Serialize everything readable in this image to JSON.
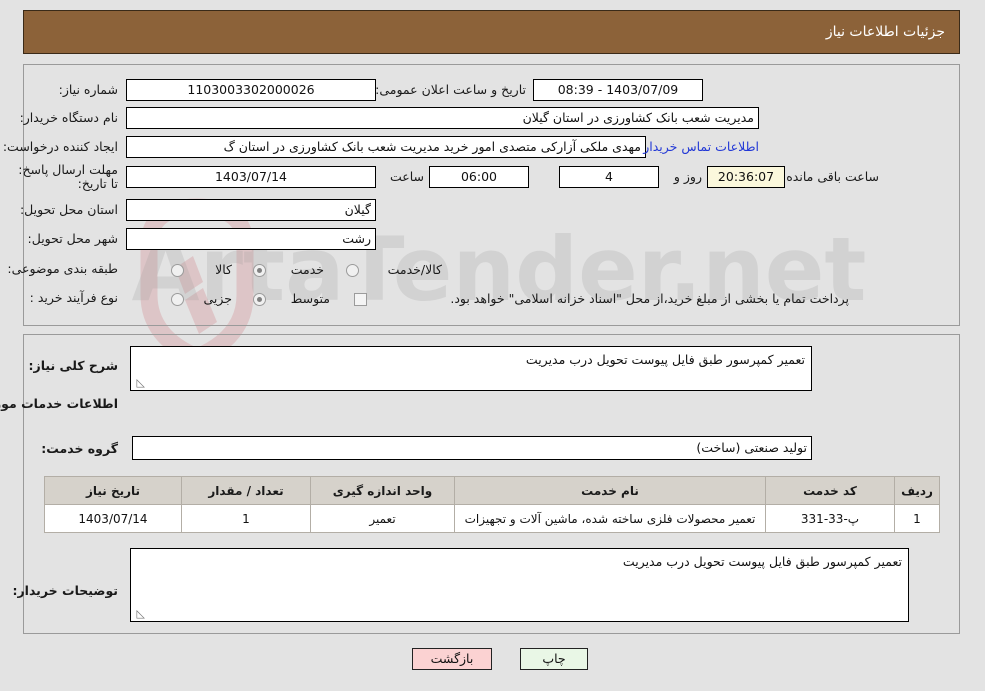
{
  "header": {
    "title": "جزئیات اطلاعات نیاز"
  },
  "form": {
    "need_number_label": "شماره نیاز:",
    "need_number_value": "1103003302000026",
    "announce_datetime_label": "تاریخ و ساعت اعلان عمومی:",
    "announce_datetime_value": "1403/07/09 - 08:39",
    "buyer_org_label": "نام دستگاه خریدار:",
    "buyer_org_value": "مدیریت شعب بانک کشاورزی در استان گیلان",
    "creator_label": "ایجاد کننده درخواست:",
    "creator_value": "مهدی ملکی آزارکی متصدی امور خرید مدیریت شعب بانک کشاورزی در استان گ",
    "contact_link": "اطلاعات تماس خریدار",
    "deadline_label": "مهلت ارسال پاسخ: تا تاریخ:",
    "deadline_date": "1403/07/14",
    "deadline_time_label": "ساعت",
    "deadline_time": "06:00",
    "remaining_days": "4",
    "days_and_label": "روز و",
    "remaining_clock": "20:36:07",
    "remaining_suffix": "ساعت باقی مانده",
    "province_label": "استان محل تحویل:",
    "province_value": "گیلان",
    "city_label": "شهر محل تحویل:",
    "city_value": "رشت",
    "category_label": "طبقه بندی موضوعی:",
    "category_options": [
      {
        "label": "کالا",
        "selected": false
      },
      {
        "label": "خدمت",
        "selected": true
      },
      {
        "label": "کالا/خدمت",
        "selected": false
      }
    ],
    "process_label": "نوع فرآیند خرید :",
    "process_options": [
      {
        "label": "جزیی",
        "selected": false
      },
      {
        "label": "متوسط",
        "selected": true
      }
    ],
    "treasury_checked": false,
    "treasury_note": "پرداخت تمام یا بخشی از مبلغ خرید،از محل \"اسناد خزانه اسلامی\" خواهد بود."
  },
  "details": {
    "summary_label": "شرح کلی نیاز:",
    "summary_value": "تعمیر کمپرسور  طبق فایل پیوست تحویل درب مدیریت",
    "services_heading": "اطلاعات خدمات مورد نیاز",
    "service_group_label": "گروه خدمت:",
    "service_group_value": "تولید صنعتی (ساخت)",
    "buyer_notes_label": "توضیحات خریدار:",
    "buyer_notes_value": "تعمیر کمپرسور  طبق فایل پیوست تحویل درب مدیریت"
  },
  "table": {
    "columns": [
      "ردیف",
      "کد خدمت",
      "نام خدمت",
      "واحد اندازه گیری",
      "تعداد / مقدار",
      "تاریخ نیاز"
    ],
    "rows": [
      {
        "row": "1",
        "code": "پ-33-331",
        "name": "تعمیر محصولات فلزی ساخته شده، ماشین آلات و تجهیزات",
        "unit": "تعمیر",
        "qty": "1",
        "date": "1403/07/14"
      }
    ]
  },
  "actions": {
    "print_label": "چاپ",
    "back_label": "بازگشت"
  },
  "watermark": {
    "text": "ArtaTender.net",
    "logo_name": "shield-logo"
  },
  "colors": {
    "header_bg": "#8c6239",
    "page_bg": "#e3e3e3",
    "link": "#2238d6",
    "print_btn": "#e9f7e6",
    "back_btn": "#fbd2d2",
    "table_header_bg": "#d6d2cb",
    "countdown_bg": "#fbf8dc"
  }
}
